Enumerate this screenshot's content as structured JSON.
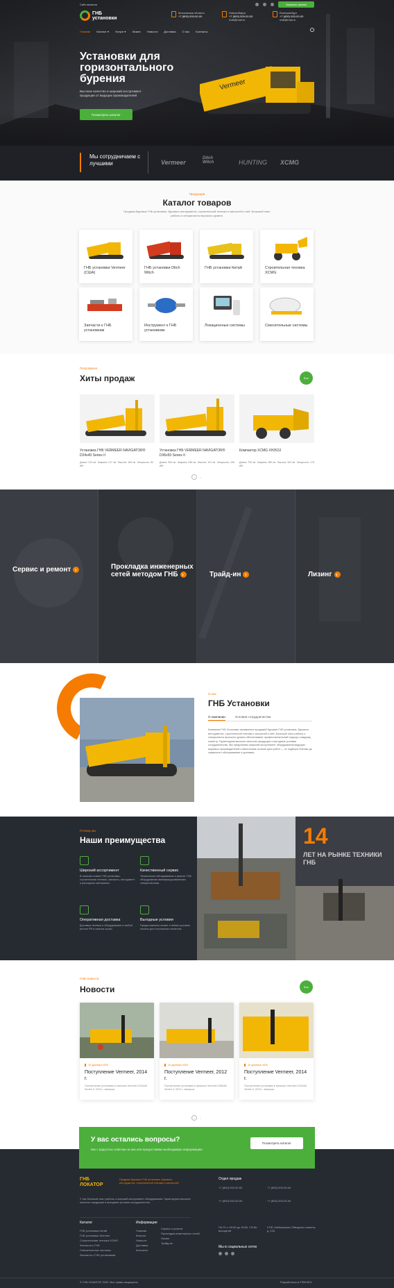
{
  "topbar": {
    "left": "Сайт-визитка",
    "cta": "Заказать звонок"
  },
  "logo": {
    "line1": "ГНБ",
    "line2": "установки"
  },
  "contacts": [
    {
      "label": "Московская область",
      "phone": "+7 (800) 000-00-00"
    },
    {
      "label": "Новосибирск",
      "phone": "+7 (800) 000-00-00",
      "email": "mail@mail.ru"
    },
    {
      "label": "Екатеринбург",
      "phone": "+7 (800) 000-00-00",
      "email": "mail@mail.ru"
    }
  ],
  "nav": [
    "Главная",
    "Каталог ▾",
    "Услуги ▾",
    "Лизинг",
    "Новости",
    "Доставка",
    "О нас",
    "Контакты"
  ],
  "hero": {
    "title": "Установки для горизонтального бурения",
    "subtitle": "Высокое качество и широкий ассортимент продукции от ведущих производителей",
    "button": "Посмотреть каталог",
    "machine_brand": "Vermeer"
  },
  "partners": {
    "title": "Мы сотрудничаем с лучшими",
    "logos": [
      "Vermeer",
      "Ditch Witch",
      "HUNTING",
      "XCMG"
    ]
  },
  "catalog": {
    "label": "Продукция",
    "title": "Каталог товаров",
    "desc": "Продажа буровых ГНБ установок, бурового инструмента, строительной техники и запчастей к ней. Большой опыт работы и специалисты высокого уровня.",
    "items": [
      "ГНБ установки Vermeer (США)",
      "ГНБ установки Ditch Witch",
      "ГНБ установки Китай",
      "Строительная техника XCMG",
      "Запчасти к ГНБ установкам",
      "Инструмент к ГНБ установкам",
      "Локационные системы",
      "Смесительные системы"
    ]
  },
  "hits": {
    "label": "Популярное",
    "title": "Хиты продаж",
    "all": "Все",
    "items": [
      {
        "name": "Установка ГНБ VERMEER NAVIGATOR® D24x40 Series II",
        "spec": "Длина: 213 см · Ширина: 217 см · Высота: 183 см · Мощность: 83 кВт"
      },
      {
        "name": "Установка ГНБ VERMEER NAVIGATOR® D36x50 Series II",
        "spec": "Длина: 300 см · Ширина: 238 см · Высота: 191 см · Мощность: 106 кВт"
      },
      {
        "name": "Компактор XCMG XH263J",
        "spec": "Длина: 700 см · Ширина: 280 см · Высота: 320 см · Мощность: 175 кВт"
      }
    ]
  },
  "services": [
    {
      "label": "Сервис и ремонт"
    },
    {
      "label": "Прокладка инженерных сетей методом ГНБ"
    },
    {
      "label": "Трайд-ин"
    },
    {
      "label": "Лизинг"
    }
  ],
  "about": {
    "label": "О нас",
    "title": "ГНБ Установки",
    "tabs": [
      "О компании",
      "Условия сотрудничества"
    ],
    "text": "Компания ГНБ Установки занимается продажей буровых ГНБ установок, бурового инструмента, строительной техники и запчастей к ней. Большой опыт работы и специалисты высокого уровня обеспечивают профессиональный подход к каждому клиенту. Гарантируем высокое качество продукции и выгодные условия сотрудничества. Мы предлагаем широкий ассортимент оборудования ведущих мировых производителей и выполняем полный цикл работ — от подбора техники до сервисного обслуживания и доставки."
  },
  "advantages": {
    "label": "Почему мы",
    "title": "Наши преимущества",
    "items": [
      {
        "title": "Широкий ассортимент",
        "text": "В наличии новые ГНБ установки, строительная техника, запчасти, инструмент и расходные материалы."
      },
      {
        "title": "Качественный сервис",
        "text": "Техническое обслуживание и ремонт ГНБ оборудования квалифицированными специалистами."
      },
      {
        "title": "Оперативная доставка",
        "text": "Доставка техники и оборудования в любой регион РФ в сжатые сроки."
      },
      {
        "title": "Выгодные условия",
        "text": "Предоставляем лизинг и гибкие условия оплаты для постоянных клиентов."
      }
    ],
    "years": "14",
    "years_text": "ЛЕТ НА РЫНКЕ ТЕХНИКИ ГНБ"
  },
  "news": {
    "label": "ГНБ Новости",
    "title": "Новости",
    "all": "Все",
    "items": [
      {
        "date": "10 декабря 2020",
        "title": "Поступление Vermeer, 2014 г.",
        "text": "Поступление установки в наличии Vermeer D24x40 Series II, 2014 г. выпуска."
      },
      {
        "date": "10 декабря 2020",
        "title": "Поступление Vermeer, 2012 г.",
        "text": "Поступление установки в наличии Vermeer D36x50 Series II, 2012 г. выпуска."
      },
      {
        "date": "10 декабря 2020",
        "title": "Поступление Vermeer, 2014 г.",
        "text": "Поступление установки в наличии Vermeer D24x40 Series II, 2014 г. выпуска."
      }
    ]
  },
  "cta": {
    "title": "У вас остались вопросы?",
    "text": "Мы с радостью ответим на них или предоставим необходимую информацию",
    "button": "Посмотреть каталог"
  },
  "footer": {
    "logo": "ГНБ ЛОКАТОР",
    "tagline": "Продажа буровых ГНБ установок, бурового инструмента, строительной техники и запчастей",
    "about": "У нас большой опыт работы и широкий ассортимент оборудования. Гарантируем высокое качество продукции и выгодные условия сотрудничества.",
    "catalog_h": "Каталог",
    "catalog": [
      "ГНБ установки Китай",
      "ГНБ установки Vermeer",
      "Строительная техника XCMG",
      "Запчасти к ГНБ",
      "Смесительные системы",
      "Запчасти к ГНБ установкам"
    ],
    "info_h": "Информация",
    "info": [
      "Главная",
      "Каталог",
      "Новости",
      "Доставка",
      "Контакты"
    ],
    "info2": [
      "Сервис и ремонт",
      "Прокладка инженерных сетей",
      "Лизинг",
      "Трайд-ин"
    ],
    "sales_h": "Отдел продаж",
    "phones": [
      "+7 (800) 000-00-00",
      "+7 (800) 000-00-00",
      "+7 (800) 000-00-00",
      "+7 (800) 000-00-00"
    ],
    "hours": "Пн-Пт с 09:00 до 18:00, Сб-Вс выходной",
    "address": "СПб, Набережная Обводного канала, д. 118",
    "social_h": "Мы в социальных сетях",
    "copyright": "© ГНБ ЛОКАТОР 2020. Все права защищены",
    "dev": "Разработано в FIRESEO"
  }
}
